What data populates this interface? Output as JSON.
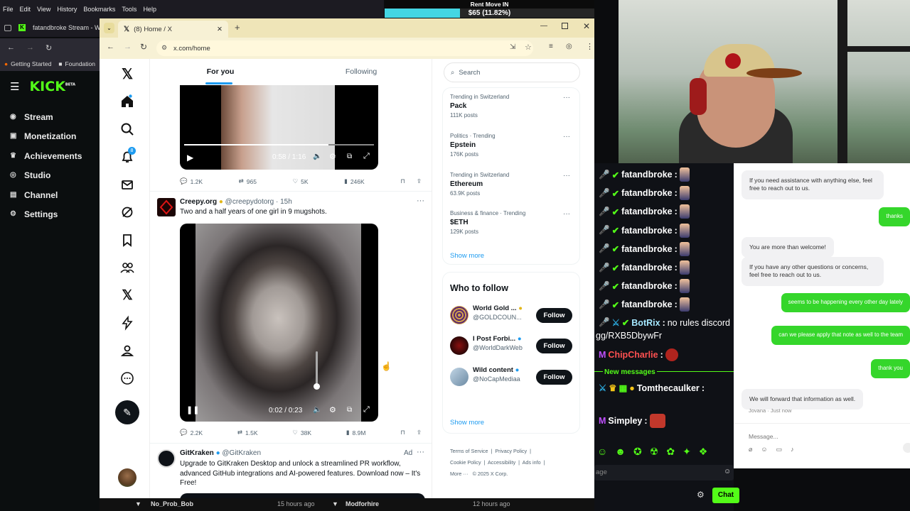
{
  "firefox": {
    "menu": [
      "File",
      "Edit",
      "View",
      "History",
      "Bookmarks",
      "Tools",
      "Help"
    ],
    "tab_title": "fatandbroke Stream - W",
    "bookmarks": [
      "Getting Started",
      "Foundation"
    ]
  },
  "kick": {
    "logo": "KICK",
    "logo_badge": "BETA",
    "items": [
      "Stream",
      "Monetization",
      "Achievements",
      "Studio",
      "Channel",
      "Settings"
    ]
  },
  "overlay": {
    "rent_title": "Rent Move IN",
    "rent_value": "$65 (11.82%)",
    "progress_fraction": 0.1182
  },
  "chrome": {
    "tab_title": "(8) Home / X",
    "url": "x.com/home"
  },
  "x": {
    "tabs": {
      "for_you": "For you",
      "following": "Following"
    },
    "notif_count": "8",
    "post1": {
      "video_time": "0:58 / 1:16",
      "replies": "1.2K",
      "reposts": "965",
      "likes": "5K",
      "views": "246K"
    },
    "post2": {
      "name": "Creepy.org",
      "handle": "@creepydotorg",
      "time": "· 15h",
      "text": "Two and a half years of one girl in 9 mugshots.",
      "video_time": "0:02 / 0:23",
      "replies": "2.2K",
      "reposts": "1.5K",
      "likes": "38K",
      "views": "8.9M"
    },
    "post3": {
      "name": "GitKraken",
      "handle": "@GitKraken",
      "ad": "Ad",
      "text": "Upgrade to GitKraken Desktop and unlock a streamlined PR workflow, advanced GitHub integrations and AI-powered features. Download now – It's Free!"
    },
    "search_placeholder": "Search",
    "trends": [
      {
        "ctx": "Trending in Switzerland",
        "name": "Pack",
        "count": "111K posts"
      },
      {
        "ctx": "Politics · Trending",
        "name": "Epstein",
        "count": "176K posts"
      },
      {
        "ctx": "Trending in Switzerland",
        "name": "Ethereum",
        "count": "63.9K posts"
      },
      {
        "ctx": "Business & finance · Trending",
        "name": "$ETH",
        "count": "129K posts"
      }
    ],
    "show_more": "Show more",
    "who_to_follow": "Who to follow",
    "follow_suggestions": [
      {
        "name": "World Gold ...",
        "handle": "@GOLDCOUN...",
        "button": "Follow"
      },
      {
        "name": "I Post Forbi...",
        "handle": "@WorldDarkWeb",
        "button": "Follow"
      },
      {
        "name": "Wild content",
        "handle": "@NoCapMediaa",
        "button": "Follow"
      }
    ],
    "footer": [
      "Terms of Service",
      "Privacy Policy",
      "Cookie Policy",
      "Accessibility",
      "Ads info",
      "More ···",
      "© 2025 X Corp."
    ]
  },
  "chat": {
    "repeat_user": "fatandbroke",
    "repeat_count": 8,
    "botrix_user": "BotRix",
    "botrix_msg": "no rules discord",
    "botrix_link": "gg/RXB5DbywFr",
    "user3": "ChipCharlie",
    "new_messages": "New messages",
    "user4": "Tomthecaulker",
    "user5": "Simpley",
    "input_placeholder": "age",
    "chat_button": "Chat"
  },
  "support": {
    "msgs": [
      {
        "dir": "in",
        "text": "If you need assistance with anything else, feel free to reach out to us."
      },
      {
        "dir": "out",
        "text": "thanks"
      },
      {
        "dir": "in",
        "text": "You are more than welcome!"
      },
      {
        "dir": "in",
        "text": "If you have any other questions or concerns, feel free to reach out to us."
      },
      {
        "dir": "out",
        "text": "seems to be happening every other day lately"
      },
      {
        "dir": "out",
        "text": "can we please apply that note as well to the team"
      },
      {
        "dir": "out",
        "text": "thank you"
      },
      {
        "dir": "in",
        "text": "We will forward that information as well."
      }
    ],
    "agent_stamp": "Jovana · Just now",
    "input_placeholder": "Message..."
  },
  "bottom": {
    "item1": "No_Prob_Bob",
    "time1": "15 hours ago",
    "item2": "Modforhire",
    "time2": "12 hours ago"
  }
}
